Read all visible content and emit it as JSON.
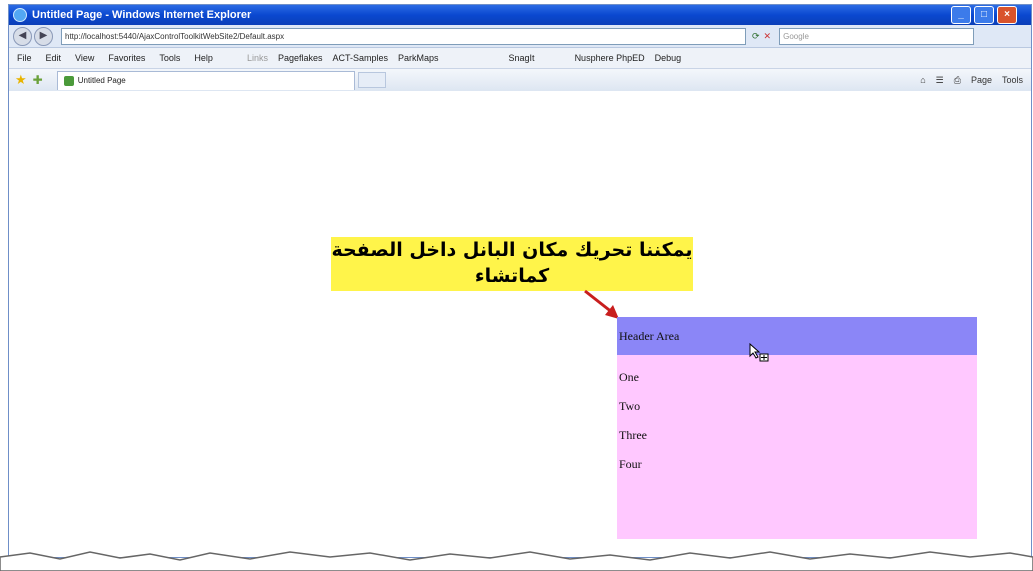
{
  "window": {
    "title": "Untitled Page - Windows Internet Explorer",
    "address": "http://localhost:5440/AjaxControlToolkitWebSite2/Default.aspx",
    "search_placeholder": "Google"
  },
  "menu": {
    "items": [
      "File",
      "Edit",
      "View",
      "Favorites",
      "Tools",
      "Help"
    ],
    "links_label": "Links",
    "links": [
      "Pageflakes",
      "ACT-Samples",
      "ParkMaps"
    ],
    "extras": [
      "SnagIt",
      "Nusphere PhpED",
      "Debug"
    ]
  },
  "tab": {
    "label": "Untitled Page"
  },
  "commands": [
    "Page",
    "Tools"
  ],
  "callout": {
    "text": "يمكننا تحريك مكان البانل داخل الصفحة كماتشاء"
  },
  "panel": {
    "header": "Header Area",
    "items": [
      "One",
      "Two",
      "Three",
      "Four"
    ]
  },
  "colors": {
    "callout_bg": "#fff44a",
    "panel_header": "#8b86f7",
    "panel_body": "#ffc8ff",
    "arrow": "#c81e1e"
  }
}
